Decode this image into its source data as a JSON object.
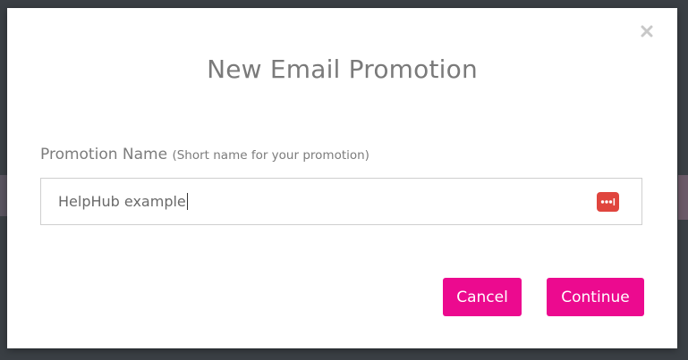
{
  "modal": {
    "title": "New Email Promotion",
    "close_icon": "close-icon"
  },
  "form": {
    "label": "Promotion Name",
    "hint": "(Short name for your promotion)",
    "value": "HelpHub example",
    "password_manager_icon": "password-manager-icon"
  },
  "actions": {
    "cancel_label": "Cancel",
    "continue_label": "Continue"
  },
  "colors": {
    "accent": "#ec0a8f",
    "password_manager": "#e0453e",
    "title_text": "#7a7a7a"
  }
}
